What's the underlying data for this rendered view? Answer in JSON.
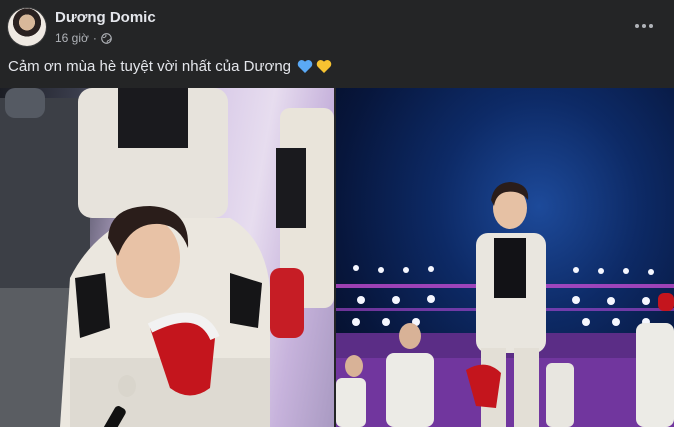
{
  "post": {
    "author_name": "Dương Domic",
    "time": "16 giờ",
    "separator": "·",
    "privacy_icon": "globe-icon",
    "more_icon": "more-options-icon",
    "caption": "Cảm ơn mùa hè tuyệt vời nhất của Dương",
    "caption_emojis": [
      "blue-heart-icon",
      "yellow-heart-icon"
    ],
    "colors": {
      "background": "#242526",
      "primary_text": "#e4e6eb",
      "secondary_text": "#b0b3b8",
      "blue_heart": "#5aa9f5",
      "yellow_heart": "#f7c331"
    }
  }
}
